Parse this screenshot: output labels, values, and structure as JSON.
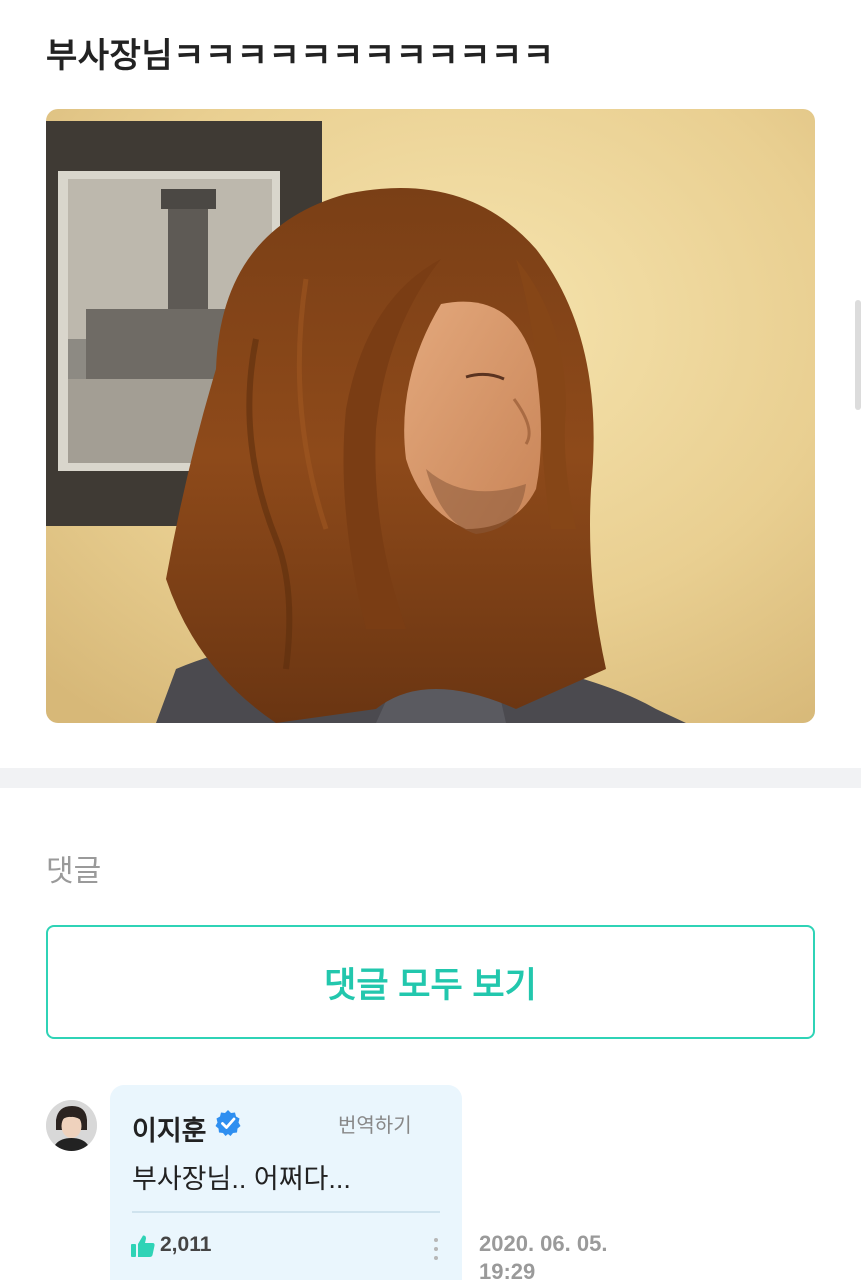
{
  "post": {
    "title": "부사장님ㅋㅋㅋㅋㅋㅋㅋㅋㅋㅋㅋㅋ",
    "photo_icon": "photo-of-long-haired-man"
  },
  "comments_section": {
    "heading": "댓글",
    "view_all_label": "댓글 모두 보기",
    "accent_color": "#2fd3b6"
  },
  "comment": {
    "author": "이지훈",
    "verified_icon": "verified-badge-icon",
    "translate_label": "번역하기",
    "text": "부사장님.. 어쩌다...",
    "like_icon": "thumbs-up-icon",
    "likes": "2,011",
    "date": "2020. 06. 05. 19:29",
    "bubble_color": "#eaf6fd"
  }
}
